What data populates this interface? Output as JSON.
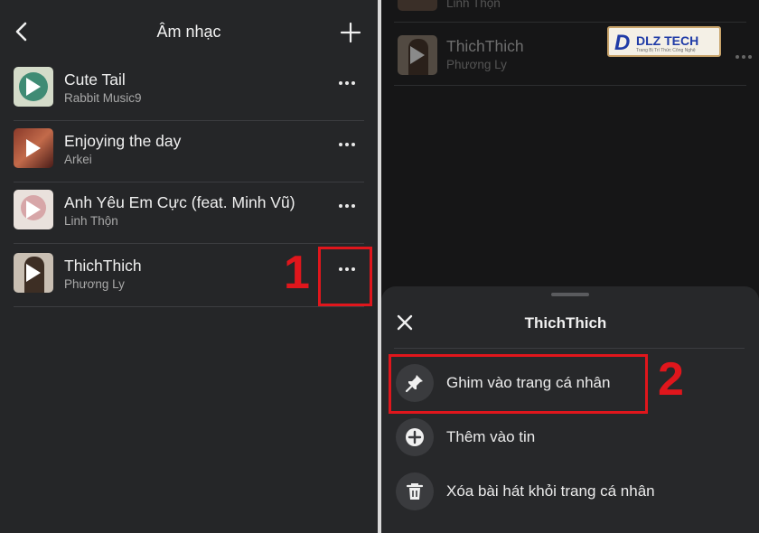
{
  "left": {
    "header": {
      "title": "Âm nhạc"
    },
    "songs": [
      {
        "name": "Cute Tail",
        "artist": "Rabbit Music9"
      },
      {
        "name": "Enjoying the day",
        "artist": "Arkei"
      },
      {
        "name": "Anh Yêu Em Cực (feat. Minh Vũ)",
        "artist": "Linh Thộn"
      },
      {
        "name": "ThichThich",
        "artist": "Phương Ly"
      }
    ],
    "annotation": "1"
  },
  "right": {
    "background_songs": [
      {
        "artist": "Linh Thộn"
      },
      {
        "name": "ThichThich",
        "artist": "Phương Ly"
      }
    ],
    "logo": {
      "mark": "D",
      "brand": "DLZ TECH",
      "tagline": "Trang Bị Trí Thức Công Nghệ"
    },
    "sheet": {
      "title": "ThichThich",
      "actions": [
        {
          "label": "Ghim vào trang cá nhân",
          "icon": "pin-icon"
        },
        {
          "label": "Thêm vào tin",
          "icon": "plus-circle-icon"
        },
        {
          "label": "Xóa bài hát khỏi trang cá nhân",
          "icon": "trash-icon"
        }
      ]
    },
    "annotation": "2"
  },
  "colors": {
    "annotation_red": "#e0161c",
    "panel_bg": "#252628",
    "sheet_bg": "#27282a"
  }
}
